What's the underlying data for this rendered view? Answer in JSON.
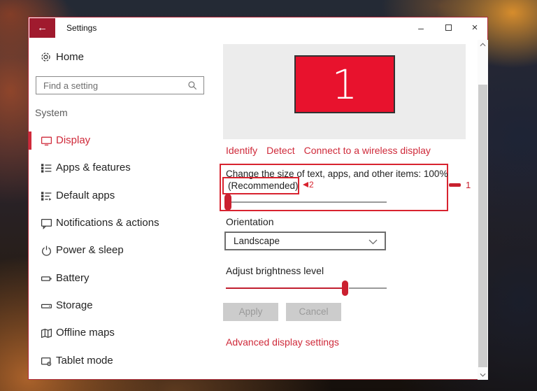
{
  "window": {
    "title": "Settings"
  },
  "titlebar": {
    "back_glyph": "←",
    "minimize_glyph": "–",
    "close_glyph": "×"
  },
  "sidebar": {
    "home_label": "Home",
    "search": {
      "placeholder": "Find a setting"
    },
    "section_header": "System",
    "items": [
      {
        "label": "Display",
        "selected": true
      },
      {
        "label": "Apps & features"
      },
      {
        "label": "Default apps"
      },
      {
        "label": "Notifications & actions"
      },
      {
        "label": "Power & sleep"
      },
      {
        "label": "Battery"
      },
      {
        "label": "Storage"
      },
      {
        "label": "Offline maps"
      },
      {
        "label": "Tablet mode"
      }
    ]
  },
  "main": {
    "display_number": "1",
    "links": {
      "identify": "Identify",
      "detect": "Detect",
      "wireless": "Connect to a wireless display"
    },
    "scaling": {
      "label_line1": "Change the size of text, apps, and other items: 100%",
      "label_line2": "(Recommended)",
      "value": "100%",
      "slider_percent": 0
    },
    "orientation": {
      "label": "Orientation",
      "value": "Landscape"
    },
    "brightness": {
      "label": "Adjust brightness level",
      "slider_percent": 74
    },
    "apply_label": "Apply",
    "cancel_label": "Cancel",
    "advanced_link": "Advanced display settings"
  },
  "annotations": {
    "callout1": "1",
    "callout2": "2"
  },
  "colors": {
    "accent_red": "#cf2a3a",
    "monitor_red": "#e8122d",
    "annotation_red": "#d8232f",
    "back_button_red": "#a01a2e",
    "disabled_button_bg": "#cccccc"
  }
}
